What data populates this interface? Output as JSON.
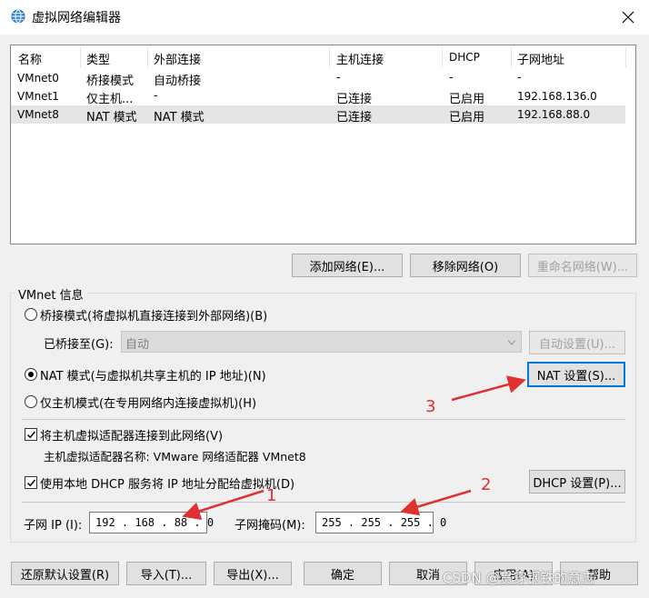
{
  "window": {
    "title": "虚拟网络编辑器",
    "icon": "globe-network-icon",
    "close_icon": "close-icon"
  },
  "list": {
    "columns": [
      "名称",
      "类型",
      "外部连接",
      "主机连接",
      "DHCP",
      "子网地址"
    ],
    "rows": [
      {
        "name": "VMnet0",
        "type": "桥接模式",
        "external": "自动桥接",
        "host": "-",
        "dhcp": "-",
        "subnet": "-"
      },
      {
        "name": "VMnet1",
        "type": "仅主机...",
        "external": "-",
        "host": "已连接",
        "dhcp": "已启用",
        "subnet": "192.168.136.0"
      },
      {
        "name": "VMnet8",
        "type": "NAT 模式",
        "external": "NAT 模式",
        "host": "已连接",
        "dhcp": "已启用",
        "subnet": "192.168.88.0",
        "selected": true
      }
    ]
  },
  "list_buttons": {
    "add": "添加网络(E)...",
    "remove": "移除网络(O)",
    "rename": "重命名网络(W)..."
  },
  "vmnet_info": {
    "label": "VMnet 信息",
    "bridged": {
      "label": "桥接模式(将虚拟机直接连接到外部网络)(B)",
      "selected": false
    },
    "bridged_to": {
      "label": "已桥接至(G):",
      "value": "自动",
      "auto_button": "自动设置(U)..."
    },
    "nat": {
      "label": "NAT 模式(与虚拟机共享主机的 IP 地址)(N)",
      "selected": true,
      "button": "NAT 设置(S)..."
    },
    "host_only": {
      "label": "仅主机模式(在专用网络内连接虚拟机)(H)",
      "selected": false
    },
    "connect_adapter": {
      "label": "将主机虚拟适配器连接到此网络(V)",
      "checked": true
    },
    "adapter_name": "主机虚拟适配器名称: VMware 网络适配器 VMnet8",
    "use_dhcp": {
      "label": "使用本地 DHCP 服务将 IP 地址分配给虚拟机(D)",
      "checked": true,
      "button": "DHCP 设置(P)..."
    },
    "subnet_ip": {
      "label": "子网 IP (I):",
      "value": "192 . 168 . 88 . 0"
    },
    "subnet_mask": {
      "label": "子网掩码(M):",
      "value": "255 . 255 . 255 . 0"
    }
  },
  "footer_buttons": {
    "restore": "还原默认设置(R)",
    "import": "导入(T)...",
    "export": "导出(X)...",
    "ok": "确定",
    "cancel": "取消",
    "apply": "应用(A)",
    "help": "帮助"
  },
  "annotations": {
    "one": "1",
    "two": "2",
    "three": "3",
    "color": "#e03030"
  },
  "watermark": "CSDN @贯穿钢铁的意志"
}
